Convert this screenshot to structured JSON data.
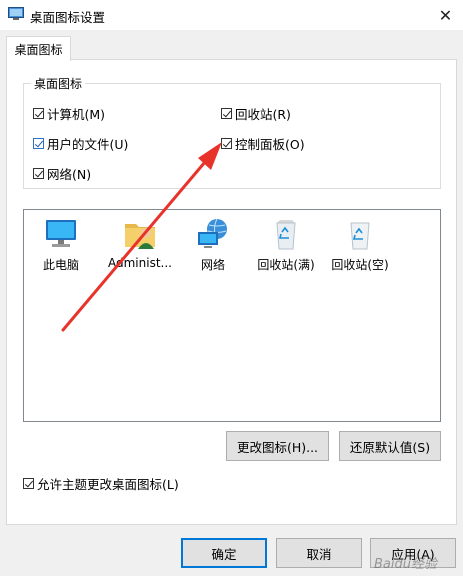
{
  "window": {
    "title": "桌面图标设置",
    "close_glyph": "✕"
  },
  "tabs": [
    {
      "label": "桌面图标"
    }
  ],
  "group": {
    "title": "桌面图标",
    "checkboxes": [
      {
        "label": "计算机(M)",
        "checked": true
      },
      {
        "label": "回收站(R)",
        "checked": true
      },
      {
        "label": "用户的文件(U)",
        "checked": true
      },
      {
        "label": "控制面板(O)",
        "checked": true
      },
      {
        "label": "网络(N)",
        "checked": true
      }
    ]
  },
  "icons": [
    {
      "label": "此电脑",
      "icon": "computer-icon"
    },
    {
      "label": "Administ...",
      "icon": "user-folder-icon"
    },
    {
      "label": "网络",
      "icon": "network-icon"
    },
    {
      "label": "回收站(满)",
      "icon": "recycle-bin-full-icon"
    },
    {
      "label": "回收站(空)",
      "icon": "recycle-bin-empty-icon"
    }
  ],
  "buttons": {
    "change_icon": "更改图标(H)...",
    "restore_default": "还原默认值(S)",
    "ok": "确定",
    "cancel": "取消",
    "apply": "应用(A)"
  },
  "theme_checkbox": {
    "label": "允许主题更改桌面图标(L)",
    "checked": true
  },
  "annotation": {
    "color": "#e8332b"
  },
  "watermark": "Baidu经验"
}
